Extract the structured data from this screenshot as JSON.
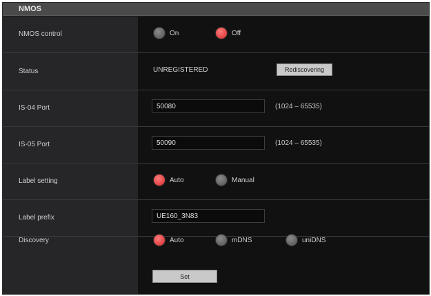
{
  "section": {
    "title": "NMOS"
  },
  "nmos_control": {
    "label": "NMOS control",
    "options": [
      {
        "label": "On",
        "selected": false
      },
      {
        "label": "Off",
        "selected": true
      }
    ]
  },
  "status": {
    "label": "Status",
    "value": "UNREGISTERED",
    "button_label": "Rediscovering"
  },
  "is04_port": {
    "label": "IS-04 Port",
    "value": "50080",
    "range": "(1024 – 65535)"
  },
  "is05_port": {
    "label": "IS-05 Port",
    "value": "50090",
    "range": "(1024 – 65535)"
  },
  "label_setting": {
    "label": "Label setting",
    "options": [
      {
        "label": "Auto",
        "selected": true
      },
      {
        "label": "Manual",
        "selected": false
      }
    ]
  },
  "label_prefix": {
    "label": "Label prefix",
    "value": "UE160_3N83"
  },
  "discovery": {
    "label": "Discovery",
    "options": [
      {
        "label": "Auto",
        "selected": true
      },
      {
        "label": "mDNS",
        "selected": false
      },
      {
        "label": "uniDNS",
        "selected": false
      }
    ]
  },
  "set_button": {
    "label": "Set"
  },
  "colors": {
    "accent": "#d22a2a",
    "panel": "#1b1b1c",
    "header": "#4a4a4a"
  }
}
